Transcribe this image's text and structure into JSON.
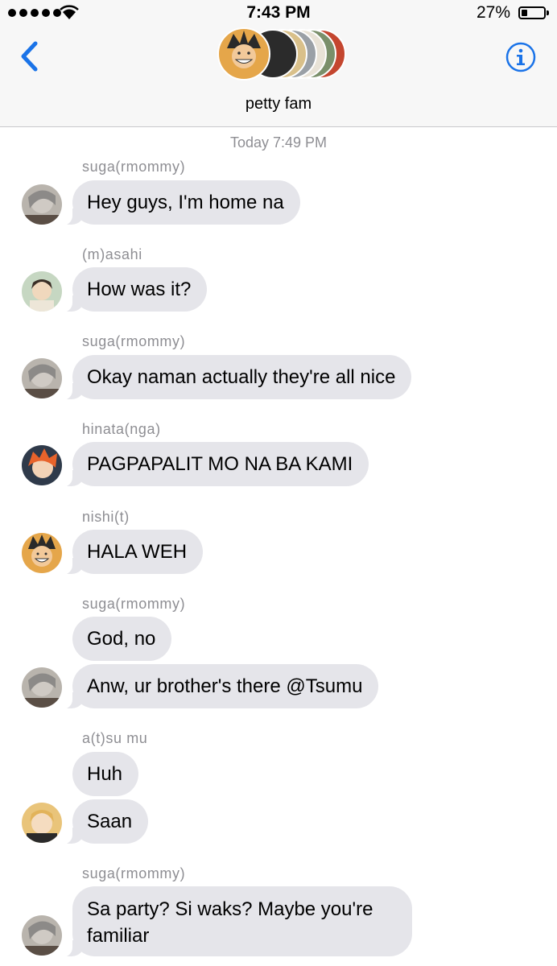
{
  "status_bar": {
    "time": "7:43 PM",
    "battery": "27%",
    "battery_level": 0.27
  },
  "header": {
    "group_name": "petty fam",
    "back_icon": "chevron-left-icon",
    "info_icon": "info-icon"
  },
  "timestamp": "Today 7:49 PM",
  "messages": [
    {
      "sender": "suga(rmommy)",
      "bubbles": [
        "Hey guys, I'm home na"
      ]
    },
    {
      "sender": "(m)asahi",
      "bubbles": [
        "How was it?"
      ]
    },
    {
      "sender": "suga(rmommy)",
      "bubbles": [
        "Okay naman actually they're all nice"
      ]
    },
    {
      "sender": "hinata(nga)",
      "bubbles": [
        "PAGPAPALIT MO NA BA KAMI"
      ]
    },
    {
      "sender": "nishi(t)",
      "bubbles": [
        "HALA WEH"
      ]
    },
    {
      "sender": "suga(rmommy)",
      "bubbles": [
        "God, no",
        "Anw, ur brother's there @Tsumu"
      ]
    },
    {
      "sender": "a(t)su mu",
      "bubbles": [
        "Huh",
        "Saan"
      ]
    },
    {
      "sender": "suga(rmommy)",
      "bubbles": [
        "Sa party? Si waks? Maybe you're familiar"
      ]
    }
  ],
  "colors": {
    "accent": "#1a73e8",
    "bubble": "#e5e5ea",
    "meta_text": "#8e8e93"
  }
}
